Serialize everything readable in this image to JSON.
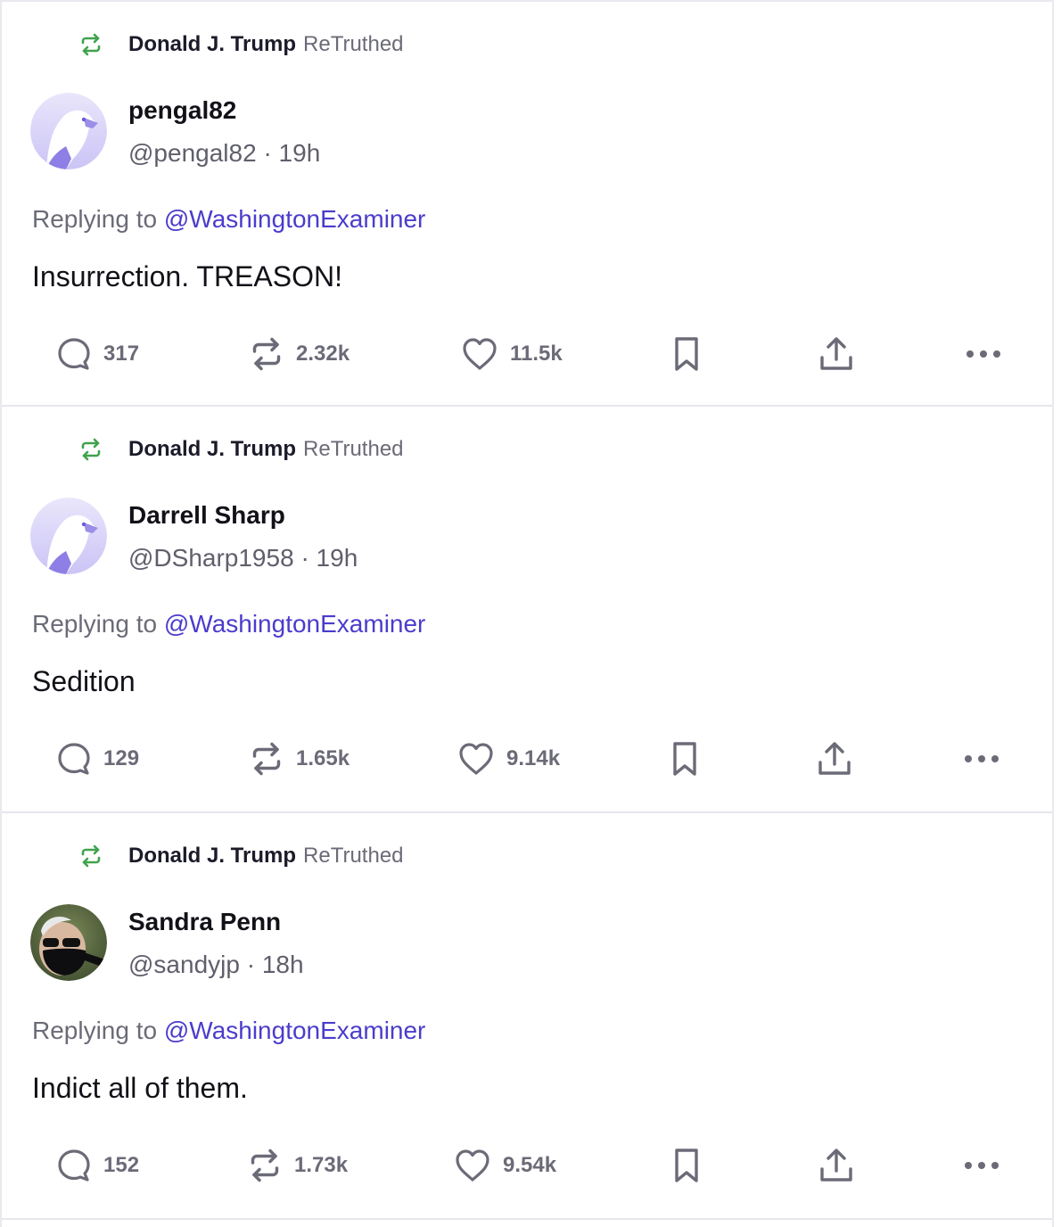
{
  "posts": [
    {
      "retruth": {
        "name": "Donald J. Trump",
        "verb": "ReTruthed"
      },
      "display_name": "pengal82",
      "handle": "@pengal82",
      "age": "19h",
      "avatar": "eagle-avatar",
      "reply_prefix": "Replying to",
      "reply_to": "@WashingtonExaminer",
      "text": "Insurrection. TREASON!",
      "replies": "317",
      "retruths": "2.32k",
      "likes": "11.5k"
    },
    {
      "retruth": {
        "name": "Donald J. Trump",
        "verb": "ReTruthed"
      },
      "display_name": "Darrell Sharp",
      "handle": "@DSharp1958",
      "age": "19h",
      "avatar": "eagle-avatar",
      "reply_prefix": "Replying to",
      "reply_to": "@WashingtonExaminer",
      "text": "Sedition",
      "replies": "129",
      "retruths": "1.65k",
      "likes": "9.14k"
    },
    {
      "retruth": {
        "name": "Donald J. Trump",
        "verb": "ReTruthed"
      },
      "display_name": "Sandra Penn",
      "handle": "@sandyjp",
      "age": "18h",
      "avatar": "photo-avatar",
      "reply_prefix": "Replying to",
      "reply_to": "@WashingtonExaminer",
      "text": "Indict all of them.",
      "replies": "152",
      "retruths": "1.73k",
      "likes": "9.54k"
    }
  ],
  "meta_separator": "·",
  "colors": {
    "retruth_green": "#3fa34d",
    "mention": "#4b3ccc",
    "muted": "#6b6b78",
    "avatar_purple": "#a79cf0"
  }
}
